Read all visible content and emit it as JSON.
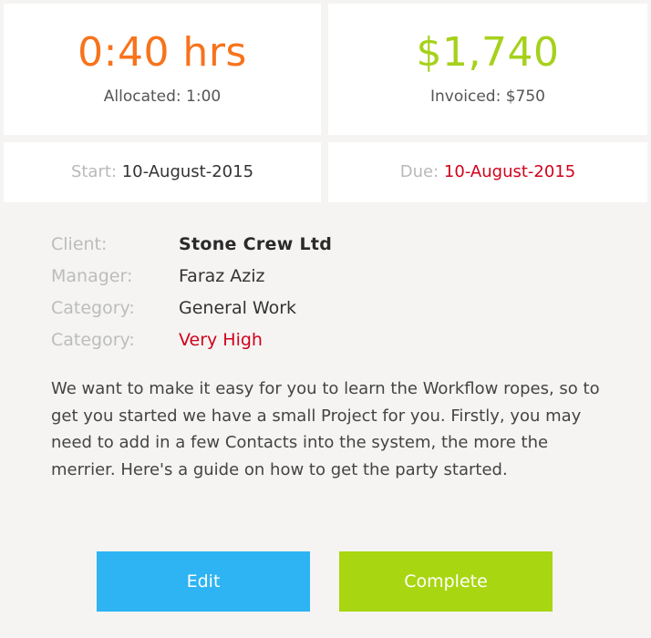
{
  "stats": {
    "hours": {
      "value": "0:40 hrs",
      "sub": "Allocated: 1:00",
      "color": "#f7731c"
    },
    "money": {
      "value": "$1,740",
      "sub": "Invoiced: $750",
      "color": "#a6d11b"
    }
  },
  "dates": {
    "start_label": "Start:",
    "start_value": "10-August-2015",
    "due_label": "Due:",
    "due_value": "10-August-2015",
    "due_color": "#d0021b"
  },
  "details": [
    {
      "label": "Client:",
      "value": "Stone Crew Ltd"
    },
    {
      "label": "Manager:",
      "value": "Faraz Aziz"
    },
    {
      "label": "Category:",
      "value": "General Work"
    },
    {
      "label": "Category:",
      "value": "Very High"
    }
  ],
  "description": "We want to make it easy for you to learn the Workflow ropes, so to get you started we have a small Project for you. Firstly, you may need to add in a few Contacts into the system, the more the merrier. Here's a guide on how to get the party started.",
  "actions": {
    "edit_label": "Edit",
    "complete_label": "Complete",
    "edit_color": "#2eb3f3",
    "complete_color": "#a8d611"
  }
}
